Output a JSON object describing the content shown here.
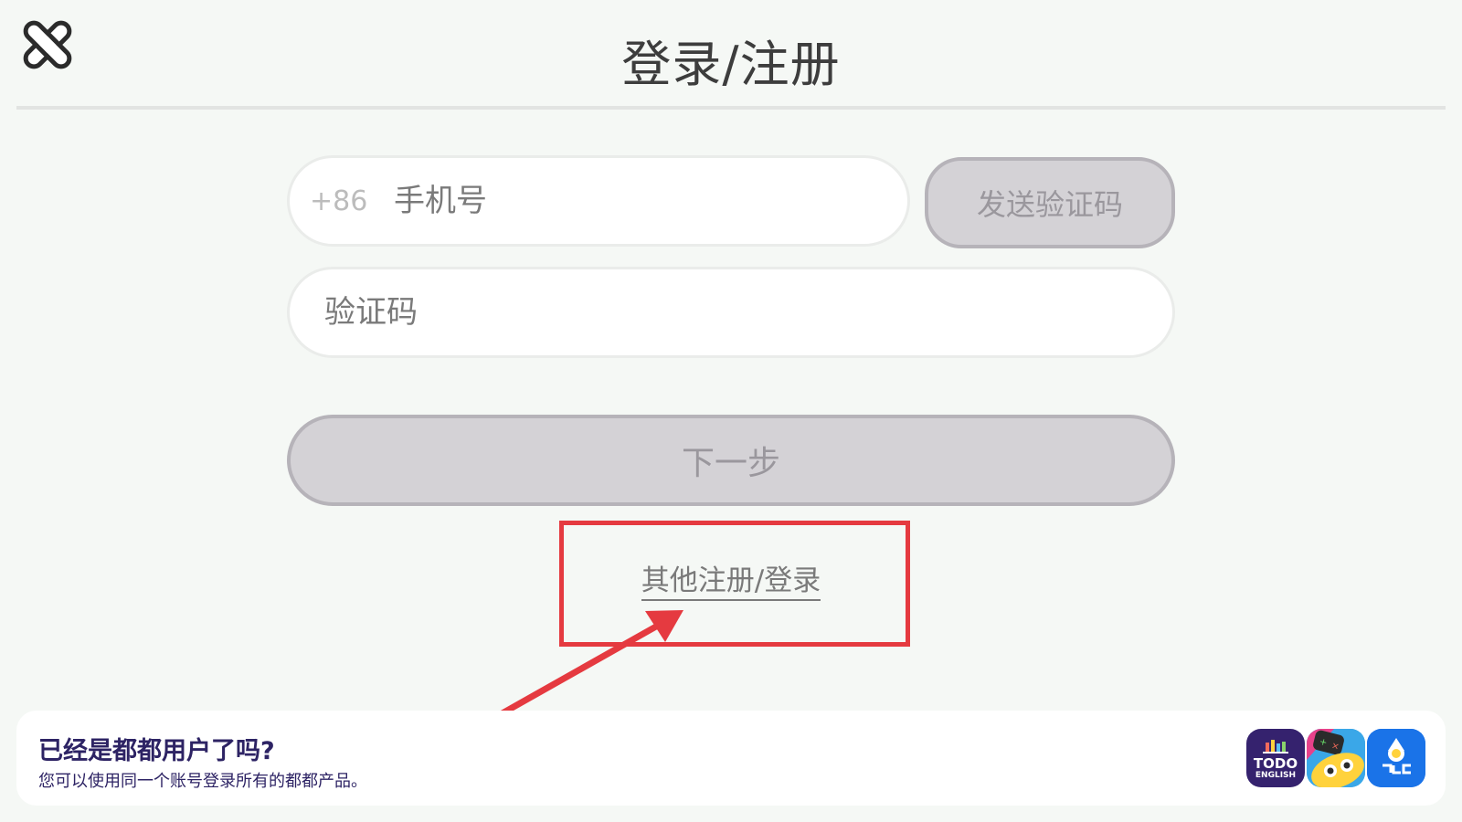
{
  "header": {
    "title": "登录/注册"
  },
  "form": {
    "country_code": "+86",
    "phone_placeholder": "手机号",
    "send_code_label": "发送验证码",
    "code_placeholder": "验证码",
    "next_label": "下一步",
    "other_login_label": "其他注册/登录"
  },
  "promo": {
    "title": "已经是都都用户了吗?",
    "subtitle": "您可以使用同一个账号登录所有的都都产品。",
    "apps": [
      {
        "line1": "TODO",
        "line2": "ENGLISH",
        "icon": "todo-english-app-icon"
      },
      {
        "icon": "todo-math-app-icon"
      },
      {
        "icon": "todo-hangul-app-icon"
      }
    ]
  },
  "colors": {
    "background": "#f5f8f5",
    "disabled_button": "#d4d2d6",
    "annotation_red": "#e53a40",
    "promo_text": "#2d2364"
  }
}
